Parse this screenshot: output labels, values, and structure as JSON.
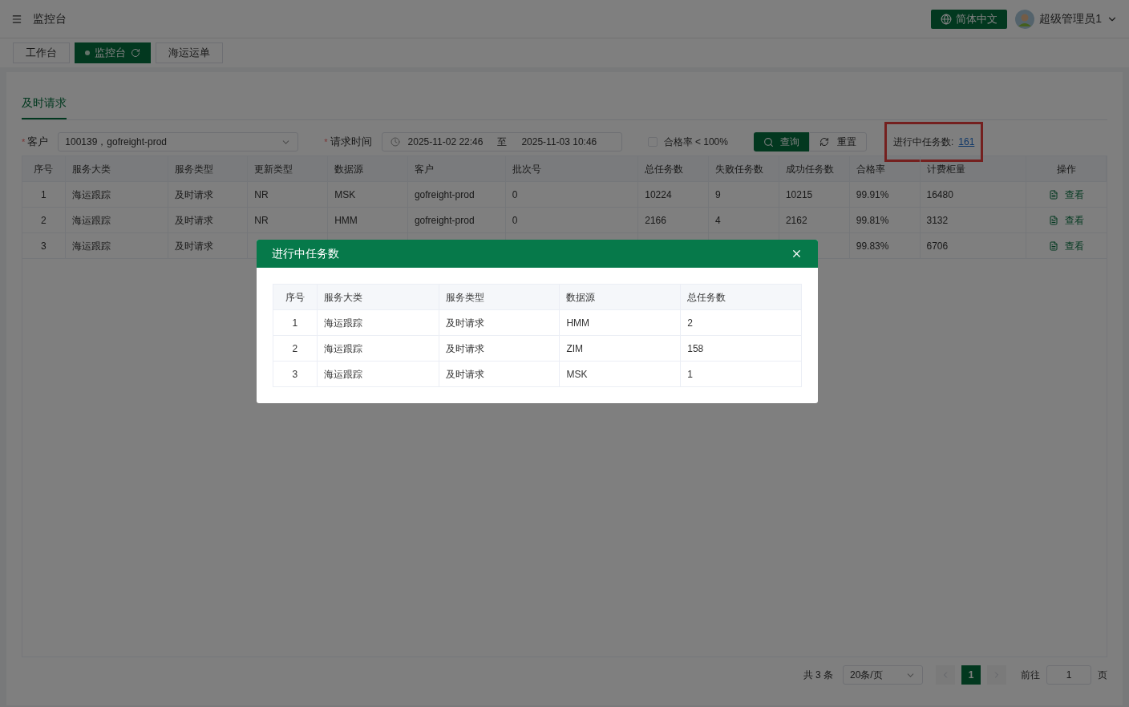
{
  "header": {
    "title": "监控台",
    "language": "简体中文",
    "user": "超级管理员1"
  },
  "tabs": [
    {
      "label": "工作台",
      "selected": false
    },
    {
      "label": "监控台",
      "selected": true
    },
    {
      "label": "海运运单",
      "selected": false
    }
  ],
  "panel_tabs": [
    {
      "label": "及时请求",
      "selected": true
    }
  ],
  "filters": {
    "customer": {
      "required_mark": "*",
      "label": "客户",
      "value": "100139，gofreight-prod"
    },
    "request_time": {
      "required_mark": "*",
      "label": "请求时间",
      "start": "2025-11-02 22:46",
      "separator": "至",
      "end": "2025-11-03 10:46"
    },
    "pass_rate": {
      "label": "合格率 < 100%",
      "checked": false
    },
    "query_button": "查询",
    "reset_button": "重置",
    "in_progress": {
      "label": "进行中任务数:",
      "value": "161",
      "highlighted": true
    }
  },
  "table": {
    "columns": [
      "序号",
      "服务大类",
      "服务类型",
      "更新类型",
      "数据源",
      "客户",
      "批次号",
      "总任务数",
      "失败任务数",
      "成功任务数",
      "合格率",
      "计费柜量",
      "操作"
    ],
    "rows": [
      {
        "cells": [
          "1",
          "海运跟踪",
          "及时请求",
          "NR",
          "MSK",
          "gofreight-prod",
          "0",
          "10224",
          "9",
          "10215",
          "99.91%",
          "16480"
        ],
        "action": "查看"
      },
      {
        "cells": [
          "2",
          "海运跟踪",
          "及时请求",
          "NR",
          "HMM",
          "gofreight-prod",
          "0",
          "2166",
          "4",
          "2162",
          "99.81%",
          "3132"
        ],
        "action": "查看"
      },
      {
        "cells": [
          "3",
          "海运跟踪",
          "及时请求",
          "",
          "",
          "",
          "",
          "",
          "",
          "",
          "99.83%",
          "6706"
        ],
        "action": "查看"
      }
    ]
  },
  "pagination": {
    "total": "共 3 条",
    "page_size": "20条/页",
    "pages": [
      {
        "label": "1",
        "selected": true
      }
    ],
    "goto_label": "前往",
    "goto_value": "1",
    "suffix": "页"
  },
  "modal": {
    "title": "进行中任务数",
    "columns": [
      "序号",
      "服务大类",
      "服务类型",
      "数据源",
      "总任务数"
    ],
    "rows": [
      [
        "1",
        "海运跟踪",
        "及时请求",
        "HMM",
        "2"
      ],
      [
        "2",
        "海运跟踪",
        "及时请求",
        "ZIM",
        "158"
      ],
      [
        "3",
        "海运跟踪",
        "及时请求",
        "MSK",
        "1"
      ]
    ]
  }
}
